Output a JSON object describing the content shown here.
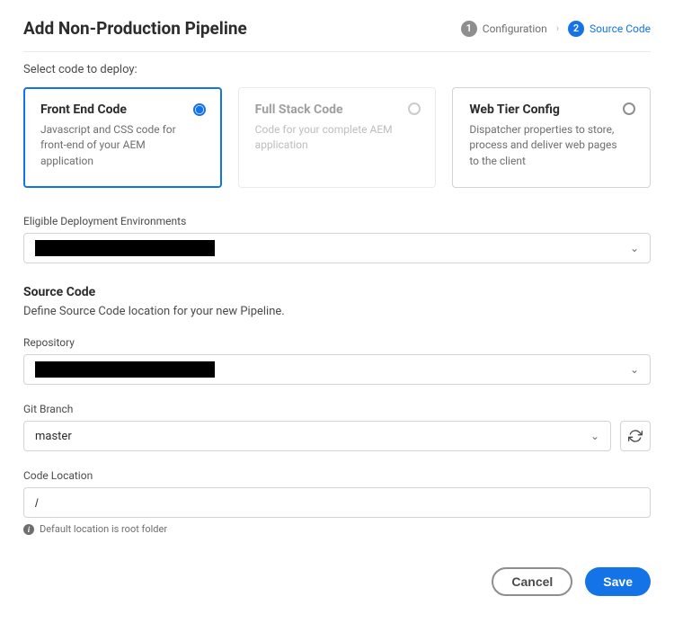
{
  "header": {
    "title": "Add Non-Production Pipeline",
    "steps": [
      {
        "num": "1",
        "label": "Configuration",
        "active": false
      },
      {
        "num": "2",
        "label": "Source Code",
        "active": true
      }
    ]
  },
  "subtitle": "Select code to deploy:",
  "cards": [
    {
      "id": "front-end",
      "title": "Front End Code",
      "desc": "Javascript and CSS code for front-end of your AEM application",
      "state": "selected"
    },
    {
      "id": "full-stack",
      "title": "Full Stack Code",
      "desc": "Code for your complete AEM application",
      "state": "disabled"
    },
    {
      "id": "web-tier",
      "title": "Web Tier Config",
      "desc": "Dispatcher properties to store, process and deliver web pages to the client",
      "state": "default"
    }
  ],
  "env": {
    "label": "Eligible Deployment Environments",
    "value_redacted": true
  },
  "source_section": {
    "heading": "Source Code",
    "sub": "Define Source Code location for your new Pipeline."
  },
  "repo": {
    "label": "Repository",
    "value_redacted": true
  },
  "branch": {
    "label": "Git Branch",
    "value": "master"
  },
  "location": {
    "label": "Code Location",
    "value": "/",
    "hint": "Default location is root folder"
  },
  "footer": {
    "cancel": "Cancel",
    "save": "Save"
  }
}
